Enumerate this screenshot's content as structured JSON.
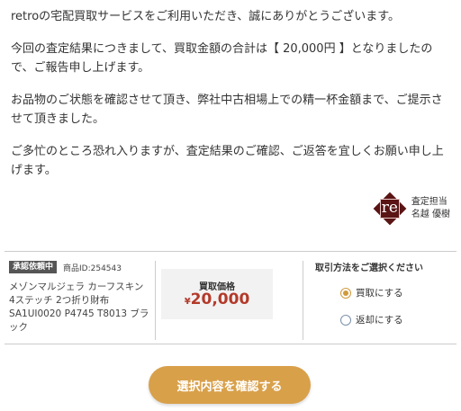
{
  "message": {
    "p1": "retroの宅配買取サービスをご利用いただき、誠にありがとうございます。",
    "p2": "今回の査定結果につきまして、買取金額の合計は【 20,000円 】となりましたので、ご報告申し上げます。",
    "p3": "お品物のご状態を確認させて頂き、弊社中古相場上での精一杯金額まで、ご提示させて頂きました。",
    "p4": "ご多忙のところ恐れ入りますが、査定結果のご確認、ご返答を宜しくお願い申し上げます。"
  },
  "inspector": {
    "logo_text": "re",
    "role": "査定担当",
    "name": "名越 優樹"
  },
  "item": {
    "status": "承認依頼中",
    "product_id": "商品ID:254543",
    "name": "メゾンマルジェラ カーフスキン 4ステッチ 2つ折り財布 SA1UI0020 P4745 T8013 ブラック",
    "price_label": "買取価格",
    "price_currency": "¥",
    "price_value": "20,000"
  },
  "method": {
    "title": "取引方法をご選択ください",
    "options": [
      {
        "label": "買取にする",
        "selected": true
      },
      {
        "label": "返却にする",
        "selected": false
      }
    ]
  },
  "confirm_button": "選択内容を確認する",
  "colors": {
    "accent": "#d9a04a",
    "price": "#b33a2a",
    "logo": "#5a1414",
    "badge": "#555555"
  }
}
